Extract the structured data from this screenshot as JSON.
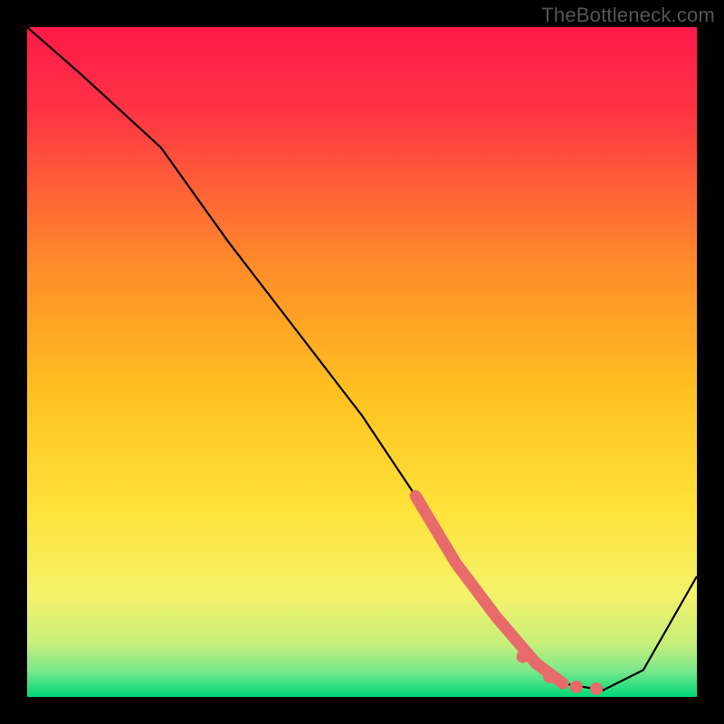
{
  "watermark": "TheBottleneck.com",
  "chart_data": {
    "type": "line",
    "title": "",
    "xlabel": "",
    "ylabel": "",
    "xlim": [
      0,
      100
    ],
    "ylim": [
      0,
      100
    ],
    "background_gradient": {
      "top": "#ff1a4a",
      "mid": "#ffd400",
      "bottom": "#00e27a"
    },
    "series": [
      {
        "name": "bottleneck-curve",
        "x": [
          0,
          8,
          20,
          30,
          40,
          50,
          58,
          64,
          70,
          76,
          80,
          86,
          92,
          100
        ],
        "y": [
          100,
          93,
          82,
          68,
          55,
          42,
          30,
          20,
          12,
          5,
          2,
          1,
          4,
          18
        ]
      }
    ],
    "highlight_segment": {
      "name": "bottleneck-highlight",
      "x": [
        58,
        64,
        70,
        76,
        80
      ],
      "y": [
        30,
        20,
        12,
        5,
        2
      ]
    },
    "highlight_points": {
      "name": "optimal-points",
      "x": [
        74,
        78,
        82,
        85
      ],
      "y": [
        6,
        3,
        1.5,
        1.2
      ]
    }
  }
}
